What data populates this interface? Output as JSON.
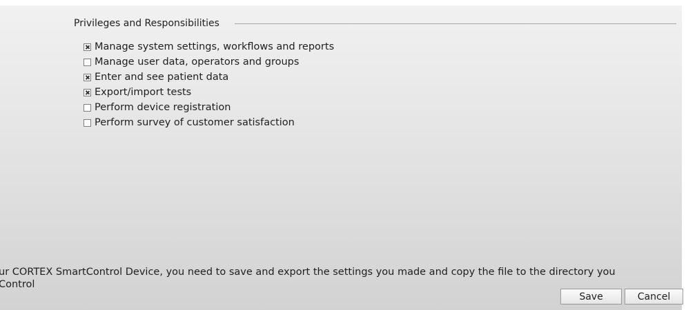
{
  "privileges": {
    "legend": "Privileges and Responsibilities",
    "items": [
      {
        "label": "Manage system settings, workflows and reports",
        "checked": true
      },
      {
        "label": "Manage user data, operators and groups",
        "checked": false
      },
      {
        "label": "Enter and see patient data",
        "checked": true
      },
      {
        "label": "Export/import tests",
        "checked": true
      },
      {
        "label": "Perform device registration",
        "checked": false
      },
      {
        "label": "Perform survey of customer satisfaction",
        "checked": false
      }
    ]
  },
  "footer": {
    "line1": "ur CORTEX SmartControl Device, you need to save and export the settings you made and copy the file to the directory you",
    "line2": "Control"
  },
  "buttons": {
    "save_label": "Save",
    "cancel_label": "Cancel"
  }
}
